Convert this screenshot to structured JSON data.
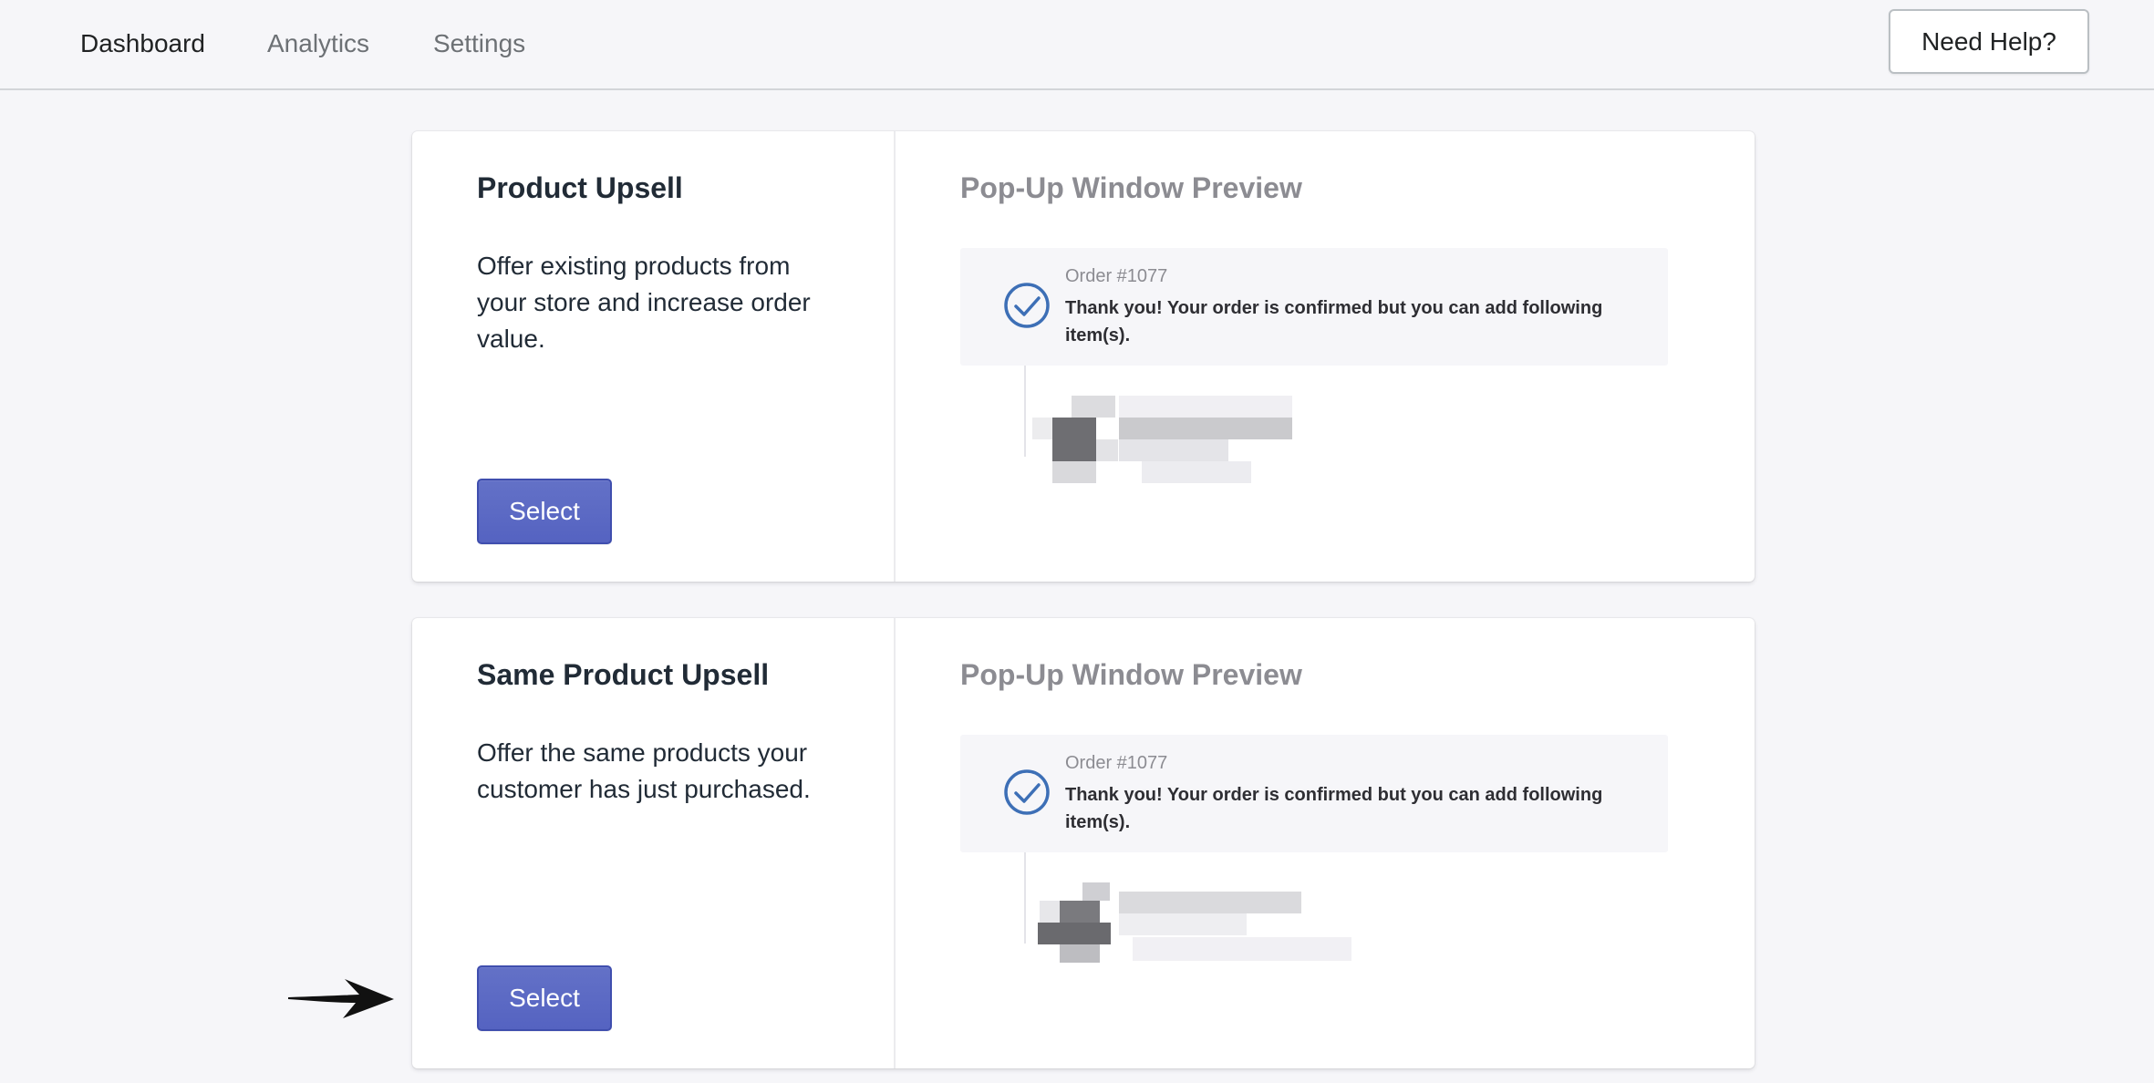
{
  "nav": {
    "tabs": [
      {
        "label": "Dashboard",
        "active": true
      },
      {
        "label": "Analytics",
        "active": false
      },
      {
        "label": "Settings",
        "active": false
      }
    ],
    "help_label": "Need Help?"
  },
  "cards": [
    {
      "title": "Product Upsell",
      "description": "Offer existing products from your store and increase order value.",
      "button_label": "Select",
      "preview": {
        "title": "Pop-Up Window Preview",
        "order_number": "Order #1077",
        "message": "Thank you! Your order is confirmed but you can add following item(s)."
      }
    },
    {
      "title": "Same Product Upsell",
      "description": "Offer the same products your customer has just purchased.",
      "button_label": "Select",
      "preview": {
        "title": "Pop-Up Window Preview",
        "order_number": "Order #1077",
        "message": "Thank you! Your order is confirmed but you can add following item(s)."
      }
    }
  ],
  "icons": {
    "check": "check-circle-icon",
    "arrow": "arrow-right-icon"
  },
  "colors": {
    "primary_button": "#5c6ac4",
    "check_icon": "#3d6fb6",
    "background": "#f6f6f9"
  }
}
